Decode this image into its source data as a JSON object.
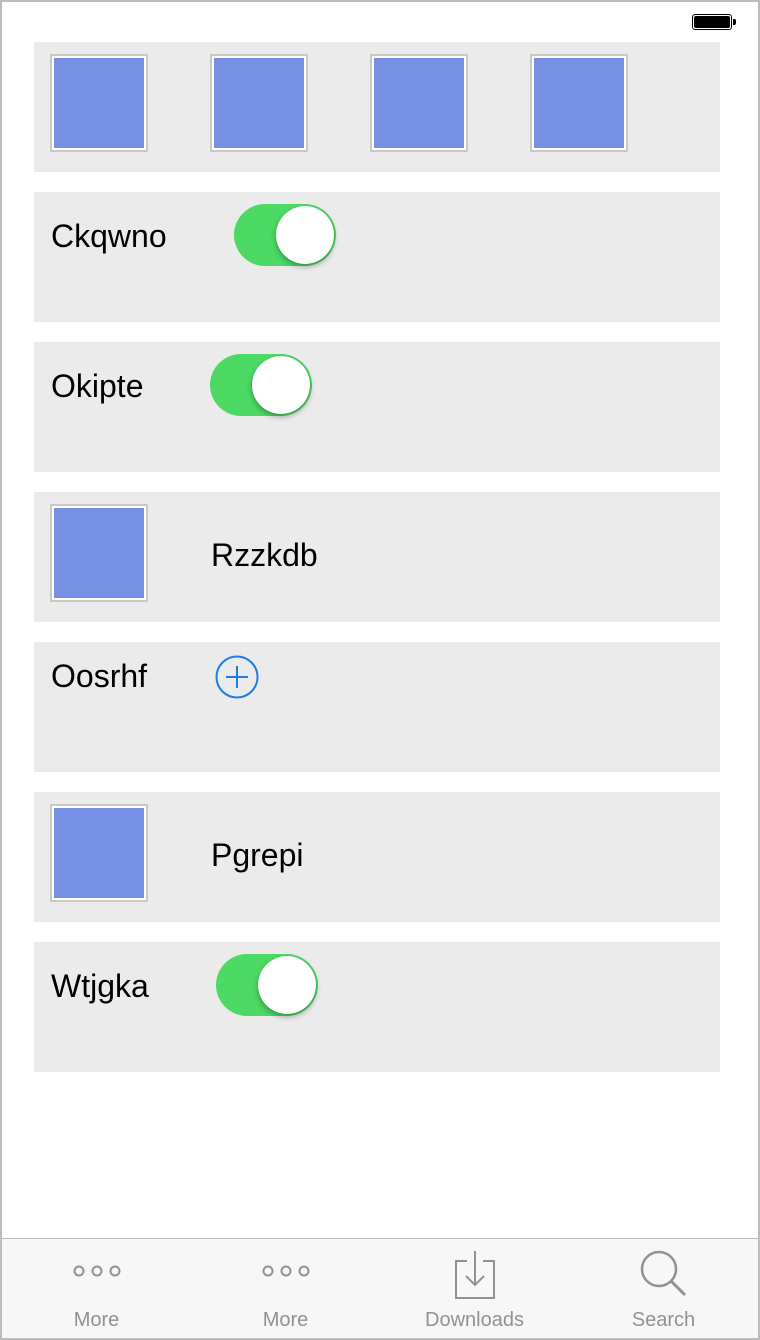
{
  "status_bar": {
    "battery_icon": "battery-full-icon"
  },
  "gallery": {
    "thumbnails": [
      "image",
      "image",
      "image",
      "image"
    ]
  },
  "rows": [
    {
      "type": "toggle",
      "label": "Ckqwno",
      "on": true
    },
    {
      "type": "toggle",
      "label": "Okipte",
      "on": true
    },
    {
      "type": "image",
      "label": "Rzzkdb"
    },
    {
      "type": "add",
      "label": "Oosrhf",
      "icon": "plus-circle-icon"
    },
    {
      "type": "image",
      "label": "Pgrepi"
    },
    {
      "type": "toggle",
      "label": "Wtjgka",
      "on": true
    }
  ],
  "tabbar": {
    "tabs": [
      {
        "label": "More",
        "icon": "more-dots-icon"
      },
      {
        "label": "More",
        "icon": "more-dots-icon"
      },
      {
        "label": "Downloads",
        "icon": "download-icon"
      },
      {
        "label": "Search",
        "icon": "search-icon"
      }
    ]
  },
  "colors": {
    "accent_green": "#4cd964",
    "thumb_blue": "#7890e4",
    "add_blue": "#1a7ee6",
    "card_bg": "#ebebeb",
    "tab_label": "#929292"
  }
}
